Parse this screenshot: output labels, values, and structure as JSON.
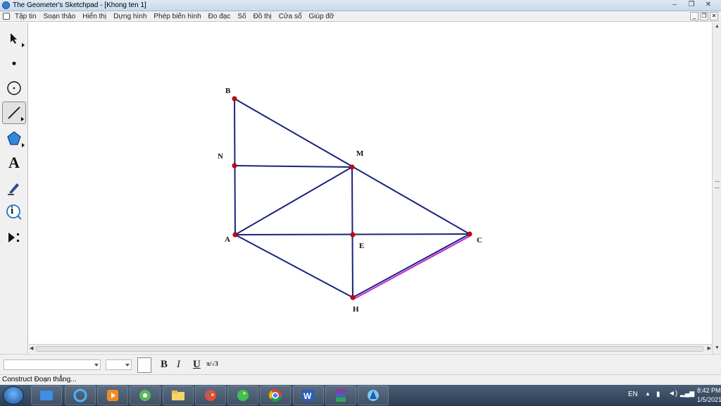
{
  "window": {
    "title": "The Geometer's Sketchpad - [Khong ten 1]"
  },
  "window_controls": [
    "–",
    "❐",
    "✕"
  ],
  "menu": [
    "Tập tin",
    "Soạn thảo",
    "Hiển thị",
    "Dựng hình",
    "Phép biến hình",
    "Đo đạc",
    "Số",
    "Đồ thị",
    "Cửa sổ",
    "Giúp đỡ"
  ],
  "mdi_controls": [
    "_",
    "❐",
    "✕"
  ],
  "tools": [
    {
      "name": "arrow-select-tool",
      "icon": "arrow-icon"
    },
    {
      "name": "point-tool",
      "icon": "dot-icon"
    },
    {
      "name": "compass-tool",
      "icon": "circle-icon"
    },
    {
      "name": "straightedge-tool",
      "icon": "segment-icon"
    },
    {
      "name": "polygon-tool",
      "icon": "pentagon-icon"
    },
    {
      "name": "text-tool",
      "icon": "letter-a-icon",
      "glyph": "A"
    },
    {
      "name": "marker-tool",
      "icon": "pen-icon"
    },
    {
      "name": "information-tool",
      "icon": "info-icon",
      "glyph": "i"
    },
    {
      "name": "custom-tool",
      "icon": "play-menu-icon"
    }
  ],
  "figure": {
    "line_color": "#1a237e",
    "highlight_color": "#c026d3",
    "point_color": "#d50000",
    "points": {
      "B": {
        "label": "B"
      },
      "N": {
        "label": "N"
      },
      "M": {
        "label": "M"
      },
      "A": {
        "label": "A"
      },
      "E": {
        "label": "E"
      },
      "C": {
        "label": "C"
      },
      "H": {
        "label": "H"
      }
    },
    "segments": [
      [
        "B",
        "A"
      ],
      [
        "B",
        "C"
      ],
      [
        "N",
        "M"
      ],
      [
        "A",
        "M"
      ],
      [
        "A",
        "C"
      ],
      [
        "A",
        "H"
      ],
      [
        "M",
        "H"
      ],
      [
        "H",
        "C"
      ]
    ],
    "selected_segment": [
      "H",
      "C"
    ]
  },
  "textbar": {
    "bold": "B",
    "italic": "I",
    "underline": "U",
    "math_symbol": "π/√3"
  },
  "status": "Construct Đoạn thẳng...",
  "taskbar": {
    "apps": [
      "windows-explorer-icon",
      "internet-explorer-icon",
      "media-player-icon",
      "coccoc-icon",
      "folder-icon",
      "paint-icon",
      "parrot-icon",
      "chrome-icon",
      "word-icon",
      "winrar-icon",
      "sketchpad-icon"
    ],
    "language": "EN",
    "time": "8:42 PM",
    "date": "1/5/2021"
  }
}
